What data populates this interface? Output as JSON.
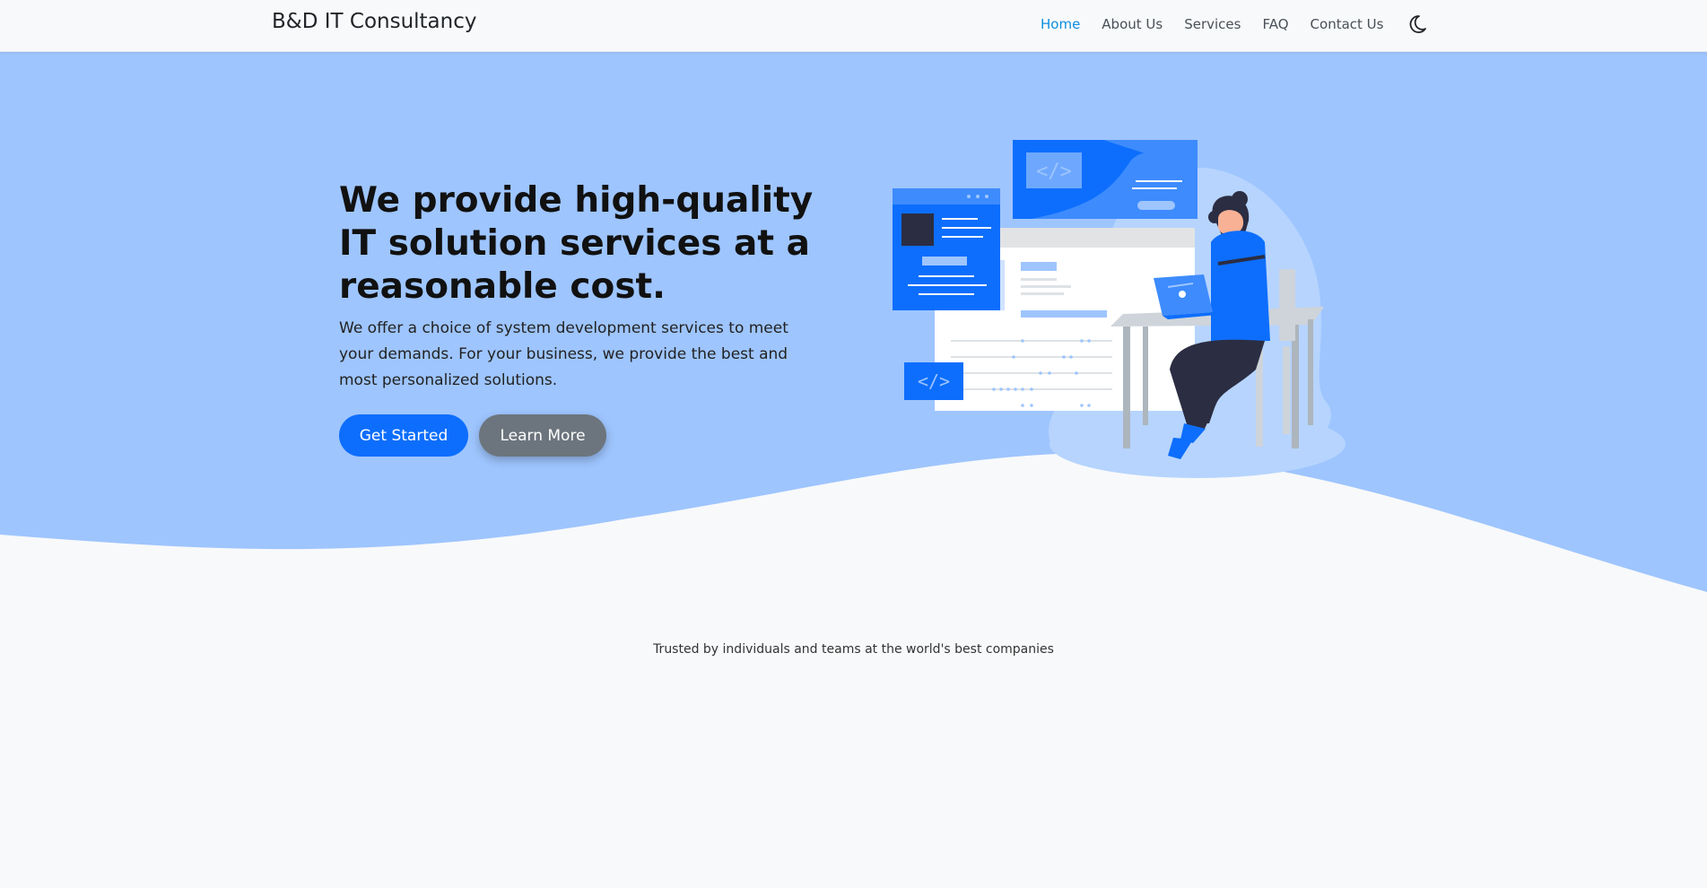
{
  "navbar": {
    "brand": "B&D IT Consultancy",
    "links": [
      {
        "label": "Home",
        "active": true
      },
      {
        "label": "About Us",
        "active": false
      },
      {
        "label": "Services",
        "active": false
      },
      {
        "label": "FAQ",
        "active": false
      },
      {
        "label": "Contact Us",
        "active": false
      }
    ],
    "theme_icon": "moon-icon"
  },
  "hero": {
    "title": "We provide high-quality IT solution services at a reasonable cost.",
    "description": "We offer a choice of system development services to meet your demands. For your business, we provide the best and most personalized solutions.",
    "primary_button": "Get Started",
    "secondary_button": "Learn More",
    "illustration": "developer-at-desk-illustration"
  },
  "trusted": {
    "text": "Trusted by individuals and teams at the world's best companies"
  },
  "colors": {
    "hero_bg": "#9ec5fe",
    "primary": "#0d6efd",
    "secondary": "#6c757d",
    "active_link": "#0d8ee0",
    "page_bg": "#f8f9fa"
  }
}
